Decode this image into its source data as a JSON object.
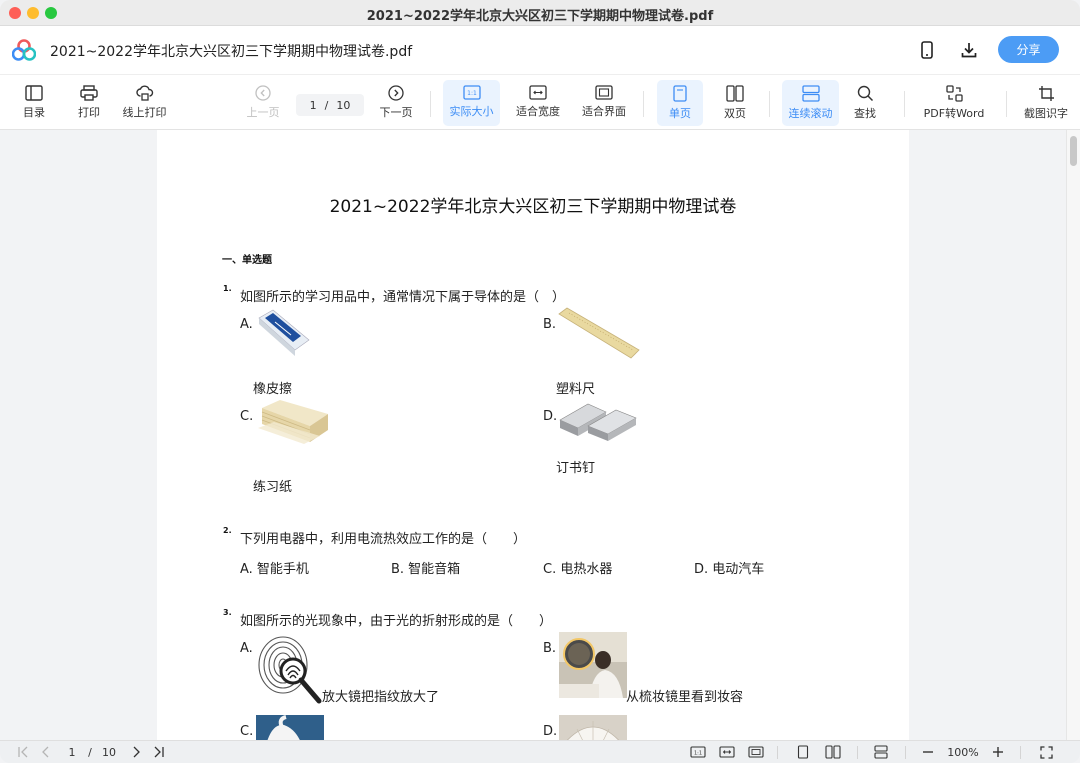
{
  "window": {
    "title": "2021~2022学年北京大兴区初三下学期期中物理试卷.pdf"
  },
  "header": {
    "doc_name": "2021~2022学年北京大兴区初三下学期期中物理试卷.pdf",
    "share_label": "分享",
    "icons": [
      "mobile-icon",
      "download-icon"
    ]
  },
  "toolbar": {
    "toc": "目录",
    "print": "打印",
    "online_print": "线上打印",
    "prev_page": "上一页",
    "current_page": "1",
    "page_sep": "/",
    "total_pages": "10",
    "next_page": "下一页",
    "actual_size": "实际大小",
    "fit_width": "适合宽度",
    "fit_page": "适合界面",
    "single_page": "单页",
    "double_page": "双页",
    "continuous_scroll": "连续滚动",
    "find": "查找",
    "pdf_to_word": "PDF转Word",
    "screenshot_ocr": "截图识字",
    "actual_size_icon_text": "1:1"
  },
  "document": {
    "title": "2021~2022学年北京大兴区初三下学期期中物理试卷",
    "section": "一、单选题",
    "q1": {
      "num": "1.",
      "text": "如图所示的学习用品中，通常情况下属于导体的是（　）",
      "options": [
        {
          "letter": "A.",
          "caption": "橡皮擦"
        },
        {
          "letter": "B.",
          "caption": "塑料尺"
        },
        {
          "letter": "C.",
          "caption": "练习纸"
        },
        {
          "letter": "D.",
          "caption": "订书钉"
        }
      ]
    },
    "q2": {
      "num": "2.",
      "text": "下列用电器中，利用电流热效应工作的是（　　）",
      "options": [
        "A. 智能手机",
        "B. 智能音箱",
        "C. 电热水器",
        "D. 电动汽车"
      ]
    },
    "q3": {
      "num": "3.",
      "text": "如图所示的光现象中，由于光的折射形成的是（　　）",
      "options": [
        {
          "letter": "A.",
          "caption": "放大镜把指纹放大了"
        },
        {
          "letter": "B.",
          "caption": "从梳妆镜里看到妆容"
        },
        {
          "letter": "C.",
          "caption": ""
        },
        {
          "letter": "D.",
          "caption": ""
        }
      ]
    }
  },
  "footer": {
    "current_page": "1",
    "page_sep": "/",
    "total_pages": "10",
    "zoom": "100%",
    "fit_icon_text": "1:1"
  },
  "colors": {
    "accent": "#4c9cf5",
    "active_bg": "#eaf3fe",
    "active_text": "#3d8df5"
  }
}
